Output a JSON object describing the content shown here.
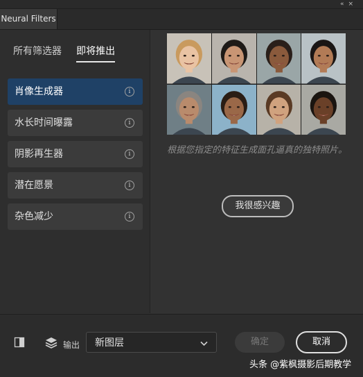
{
  "window": {
    "title": "Neural Filters",
    "controls": [
      "«",
      "×"
    ]
  },
  "filter_tabs": {
    "all": "所有筛选器",
    "upcoming": "即将推出"
  },
  "filters": [
    {
      "label": "肖像生成器",
      "active": true
    },
    {
      "label": "水长时间曝露",
      "active": false
    },
    {
      "label": "阴影再生器",
      "active": false
    },
    {
      "label": "潜在愿景",
      "active": false
    },
    {
      "label": "杂色减少",
      "active": false
    }
  ],
  "info_glyph": "i",
  "preview": {
    "description": "根据您指定的特征生成面孔逼真的独特照片。",
    "interest_button": "我很感兴趣",
    "faces": [
      {
        "bg": "#c8c2b8",
        "skin": "#e9c3a3",
        "hair": "#c99a5e"
      },
      {
        "bg": "#b9b4ad",
        "skin": "#c89574",
        "hair": "#1e1a17"
      },
      {
        "bg": "#9aa6a7",
        "skin": "#8a5a3c",
        "hair": "#2a1f1a"
      },
      {
        "bg": "#b9c2c6",
        "skin": "#b27b56",
        "hair": "#1a1615"
      },
      {
        "bg": "#6f7f86",
        "skin": "#b98b6c",
        "hair": "#8a8580"
      },
      {
        "bg": "#8cb2c9",
        "skin": "#9a6848",
        "hair": "#2a1d15"
      },
      {
        "bg": "#b7b2a8",
        "skin": "#d0a27e",
        "hair": "#5a3a24"
      },
      {
        "bg": "#a9a9a3",
        "skin": "#6a4028",
        "hair": "#1a1410"
      }
    ]
  },
  "footer": {
    "output_label": "输出",
    "output_value": "新图层",
    "ok_label": "确定",
    "cancel_label": "取消"
  },
  "watermark": "头条 @紫枫摄影后期教学"
}
